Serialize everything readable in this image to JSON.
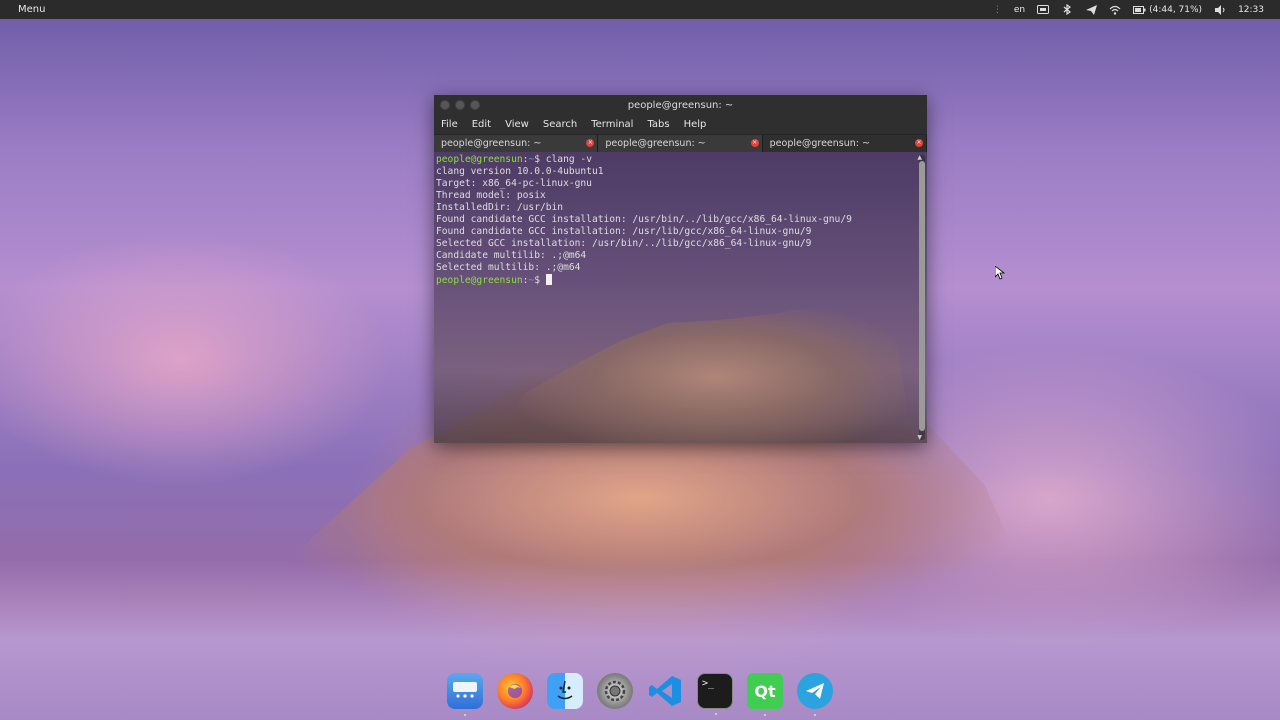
{
  "top_panel": {
    "menu_label": "Menu",
    "lang": "en",
    "battery": "(4:44, 71%)",
    "clock": "12:33"
  },
  "window": {
    "title": "people@greensun: ~",
    "menu": [
      "File",
      "Edit",
      "View",
      "Search",
      "Terminal",
      "Tabs",
      "Help"
    ],
    "tabs": [
      {
        "label": "people@greensun: ~"
      },
      {
        "label": "people@greensun: ~"
      },
      {
        "label": "people@greensun: ~"
      }
    ]
  },
  "terminal": {
    "prompt_user": "people@greensun",
    "prompt_sep": ":",
    "prompt_path": "~",
    "prompt_symbol": "$",
    "command": " clang -v",
    "output": [
      "clang version 10.0.0-4ubuntu1",
      "Target: x86_64-pc-linux-gnu",
      "Thread model: posix",
      "InstalledDir: /usr/bin",
      "Found candidate GCC installation: /usr/bin/../lib/gcc/x86_64-linux-gnu/9",
      "Found candidate GCC installation: /usr/lib/gcc/x86_64-linux-gnu/9",
      "Selected GCC installation: /usr/bin/../lib/gcc/x86_64-linux-gnu/9",
      "Candidate multilib: .;@m64",
      "Selected multilib: .;@m64"
    ]
  },
  "dock": {
    "items": [
      "launcher-icon",
      "firefox-icon",
      "finder-icon",
      "settings-icon",
      "vscode-icon",
      "terminal-icon",
      "qt-icon",
      "telegram-icon"
    ],
    "terminal_glyph": ">_",
    "qt_label": "Qt"
  },
  "colors": {
    "prompt": "#8ae234",
    "path": "#729fcf",
    "panel": "#2b2b2b",
    "close": "#e0443e"
  }
}
